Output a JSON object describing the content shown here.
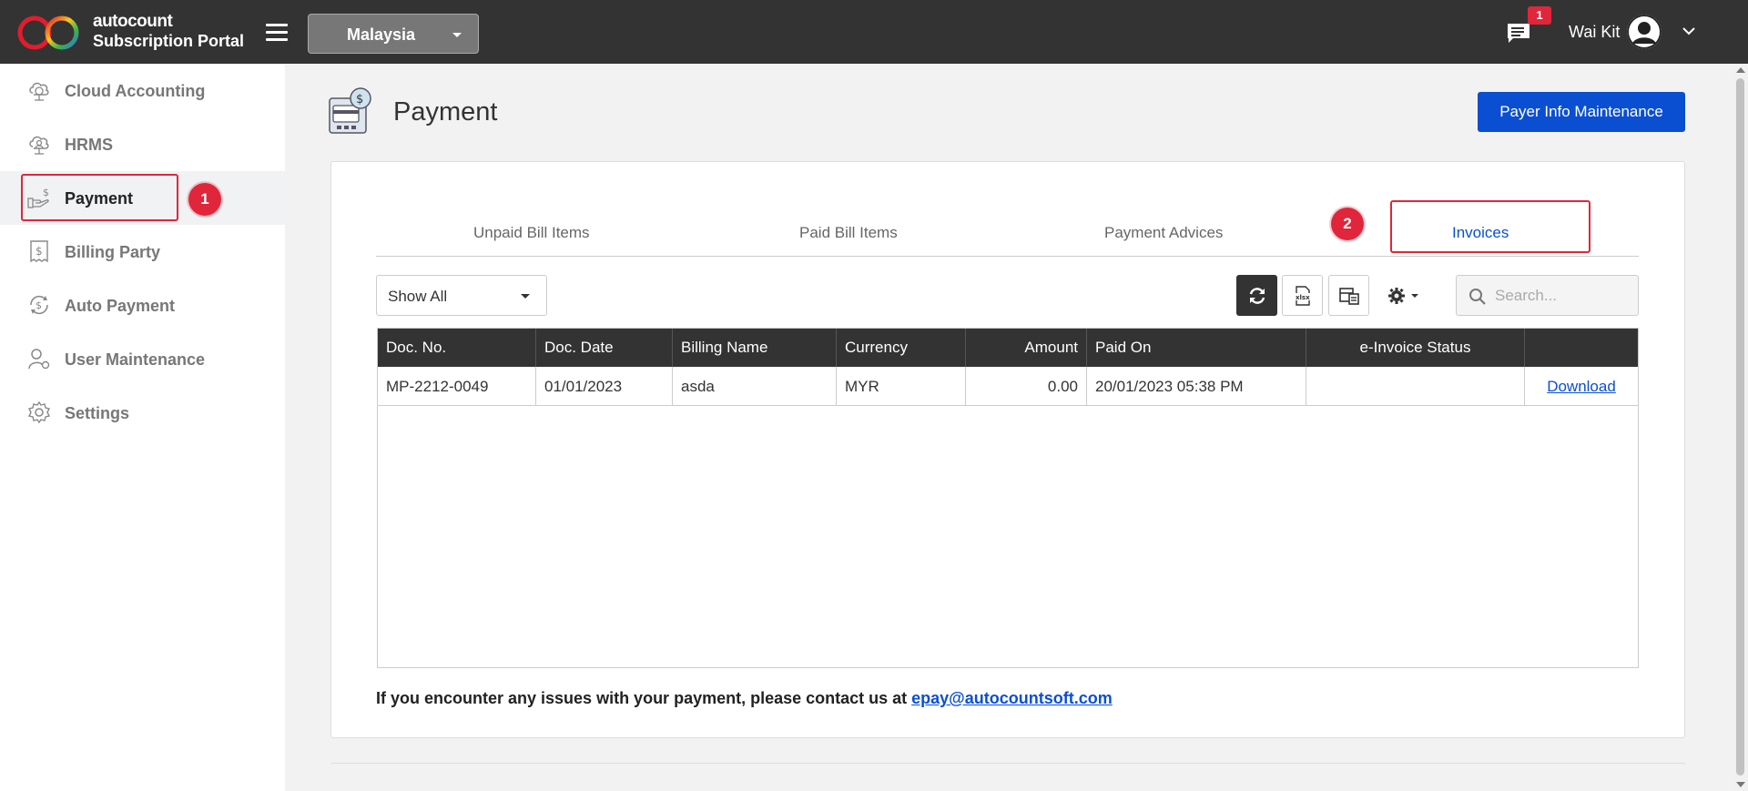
{
  "header": {
    "brand_top": "autocount",
    "brand_bottom": "Subscription Portal",
    "country": "Malaysia",
    "chat_badge": "1",
    "user_name": "Wai Kit"
  },
  "sidebar": {
    "items": [
      {
        "label": "Cloud Accounting",
        "icon": "cloud-accounting-icon"
      },
      {
        "label": "HRMS",
        "icon": "hrms-icon"
      },
      {
        "label": "Payment",
        "icon": "payment-icon",
        "active": true
      },
      {
        "label": "Billing Party",
        "icon": "billing-party-icon"
      },
      {
        "label": "Auto Payment",
        "icon": "auto-payment-icon"
      },
      {
        "label": "User Maintenance",
        "icon": "user-maintenance-icon"
      },
      {
        "label": "Settings",
        "icon": "settings-icon"
      }
    ]
  },
  "annotations": [
    "1",
    "2"
  ],
  "page": {
    "title": "Payment",
    "payer_button": "Payer Info Maintenance"
  },
  "tabs": [
    {
      "label": "Unpaid Bill Items"
    },
    {
      "label": "Paid Bill Items"
    },
    {
      "label": "Payment Advices"
    },
    {
      "label": "Invoices",
      "active": true
    }
  ],
  "toolbar": {
    "filter_value": "Show All",
    "search_placeholder": "Search..."
  },
  "table": {
    "columns": [
      "Doc. No.",
      "Doc. Date",
      "Billing Name",
      "Currency",
      "Amount",
      "Paid On",
      "e-Invoice Status",
      ""
    ],
    "rows": [
      {
        "doc_no": "MP-2212-0049",
        "doc_date": "01/01/2023",
        "billing_name": "asda",
        "currency": "MYR",
        "amount": "0.00",
        "paid_on": "20/01/2023 05:38 PM",
        "einvoice_status": "",
        "action": "Download"
      }
    ]
  },
  "note": {
    "text": "If you encounter any issues with your payment, please contact us at ",
    "email": "epay@autocountsoft.com"
  },
  "colors": {
    "topbar": "#333333",
    "primary": "#0a4fd1",
    "annotation": "#e0263b"
  }
}
